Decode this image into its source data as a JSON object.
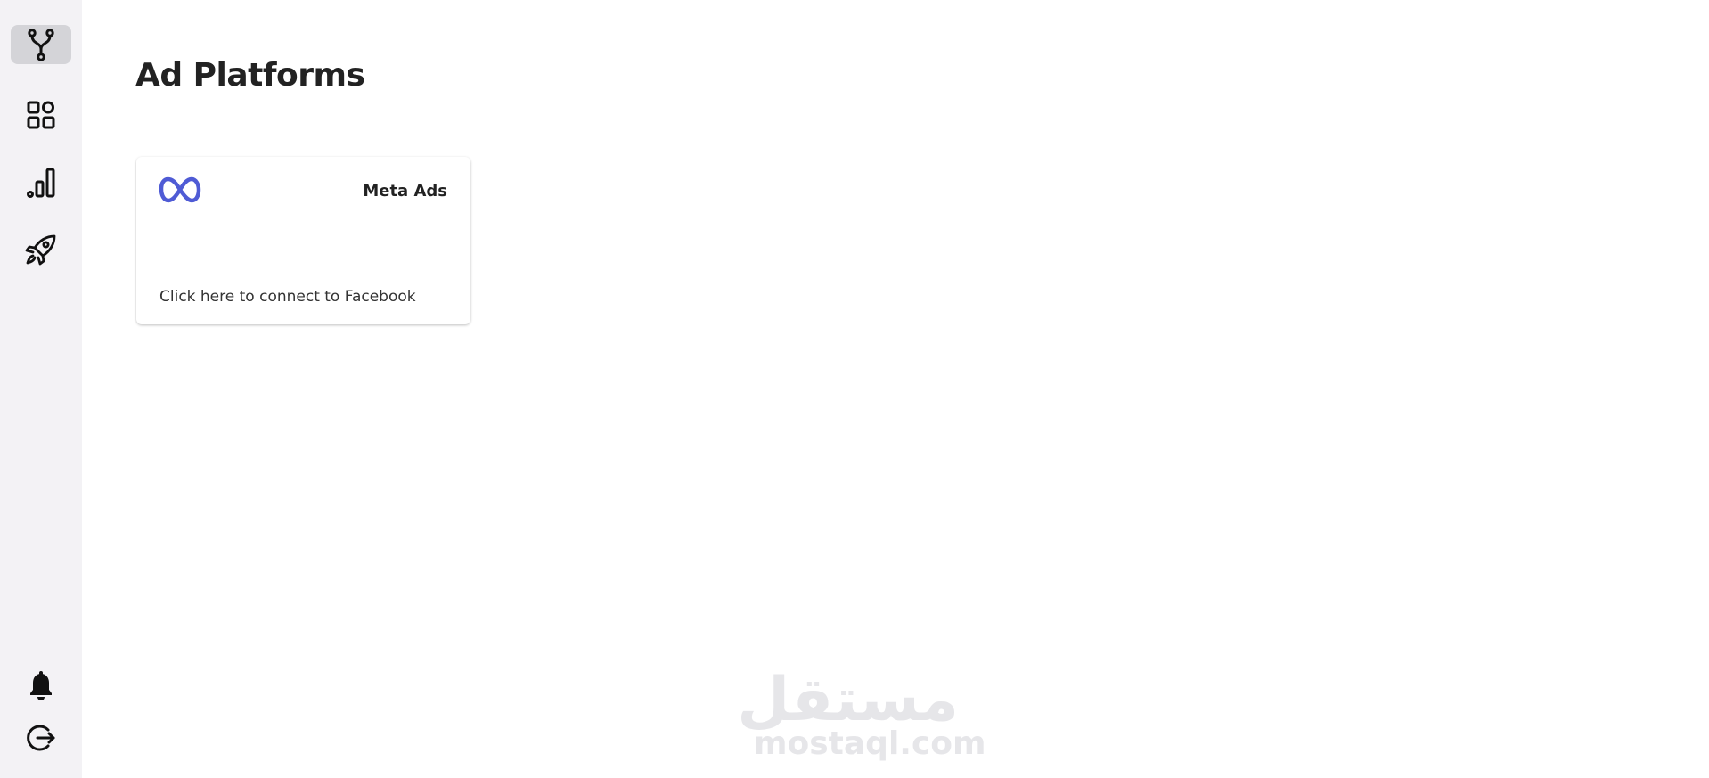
{
  "sidebar": {
    "items": [
      {
        "icon": "fork-icon",
        "active": true
      },
      {
        "icon": "apps-grid-icon",
        "active": false
      },
      {
        "icon": "bar-chart-icon",
        "active": false
      },
      {
        "icon": "rocket-icon",
        "active": false
      }
    ],
    "bottom_items": [
      {
        "icon": "bell-icon"
      },
      {
        "icon": "logout-icon"
      }
    ],
    "active_bg": "#d4d4d8",
    "bg": "#f3f2f5"
  },
  "main": {
    "title": "Ad Platforms",
    "platforms": [
      {
        "name": "Meta Ads",
        "icon": "meta-infinity-icon",
        "brand_color": "#4f5bd5",
        "action": "Click here to connect to Facebook"
      }
    ]
  },
  "watermark": {
    "arabic": "مستقل",
    "latin": "mostaql.com"
  }
}
